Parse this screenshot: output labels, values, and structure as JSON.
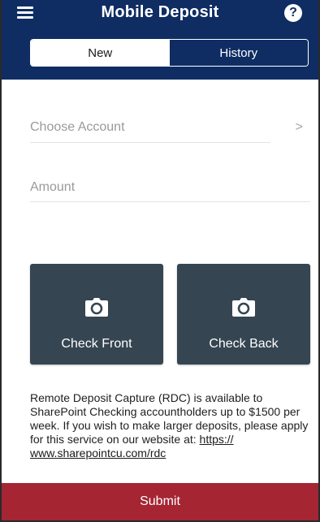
{
  "header": {
    "title": "Mobile Deposit",
    "menu_icon": "hamburger-menu-icon",
    "help_icon": "question-mark-icon",
    "help_glyph": "?"
  },
  "tabs": [
    {
      "label": "New",
      "active": true
    },
    {
      "label": "History",
      "active": false
    }
  ],
  "form": {
    "account_placeholder": "Choose Account",
    "account_chevron": ">",
    "amount_placeholder": "Amount"
  },
  "capture": {
    "front_label": "Check Front",
    "back_label": "Check Back",
    "icon": "camera-icon"
  },
  "notice": {
    "text": "Remote Deposit Capture (RDC) is available to SharePoint Checking accountholders up to $1500 per week. If you wish to make larger deposits, please apply for this service on our website at: ",
    "link_line1": "https://",
    "link_line2": "www.sharepointcu.com/rdc"
  },
  "footer": {
    "submit_label": "Submit"
  },
  "colors": {
    "header_bg": "#0f2d63",
    "tile_bg": "#354551",
    "submit_bg": "#a52533"
  }
}
